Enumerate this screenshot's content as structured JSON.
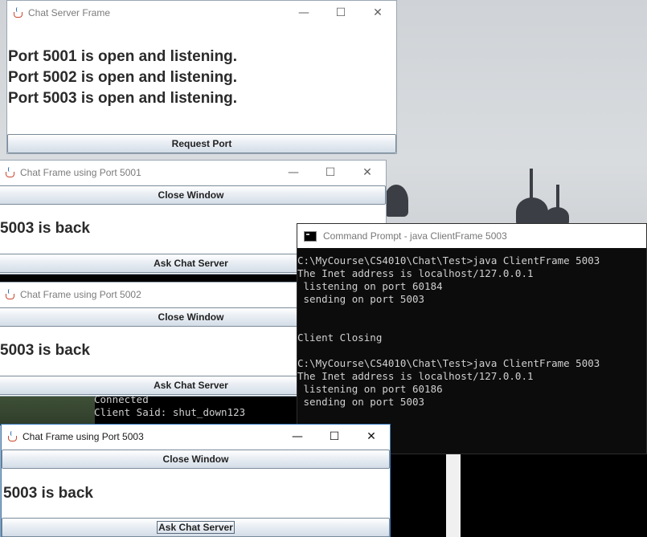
{
  "server": {
    "title": "Chat Server Frame",
    "messages": [
      "Port 5001 is open and listening.",
      "Port 5002 is open and listening.",
      "Port 5003 is open and listening."
    ],
    "request_port_label": "Request Port"
  },
  "chat_frames": [
    {
      "title": "Chat Frame using Port 5001",
      "close_label": "Close Window",
      "message": "5003 is back",
      "ask_label": "Ask Chat Server"
    },
    {
      "title": "Chat Frame using Port 5002",
      "close_label": "Close Window",
      "message": "5003 is back",
      "ask_label": "Ask Chat Server"
    },
    {
      "title": "Chat Frame using Port 5003",
      "close_label": "Close Window",
      "message": "5003 is back",
      "ask_label": "Ask Chat Server"
    }
  ],
  "console": {
    "title": "Command Prompt - java  ClientFrame 5003",
    "lines": [
      "C:\\MyCourse\\CS4010\\Chat\\Test>java ClientFrame 5003",
      "The Inet address is localhost/127.0.0.1",
      " listening on port 60184",
      " sending on port 5003",
      "",
      "",
      "Client Closing",
      "",
      "C:\\MyCourse\\CS4010\\Chat\\Test>java ClientFrame 5003",
      "The Inet address is localhost/127.0.0.1",
      " listening on port 60186",
      " sending on port 5003"
    ]
  },
  "server_console": {
    "lines": [
      "Connected",
      "Client Said: shut_down123"
    ]
  },
  "controls": {
    "minimize": "—",
    "maximize": "☐",
    "close": "✕"
  }
}
